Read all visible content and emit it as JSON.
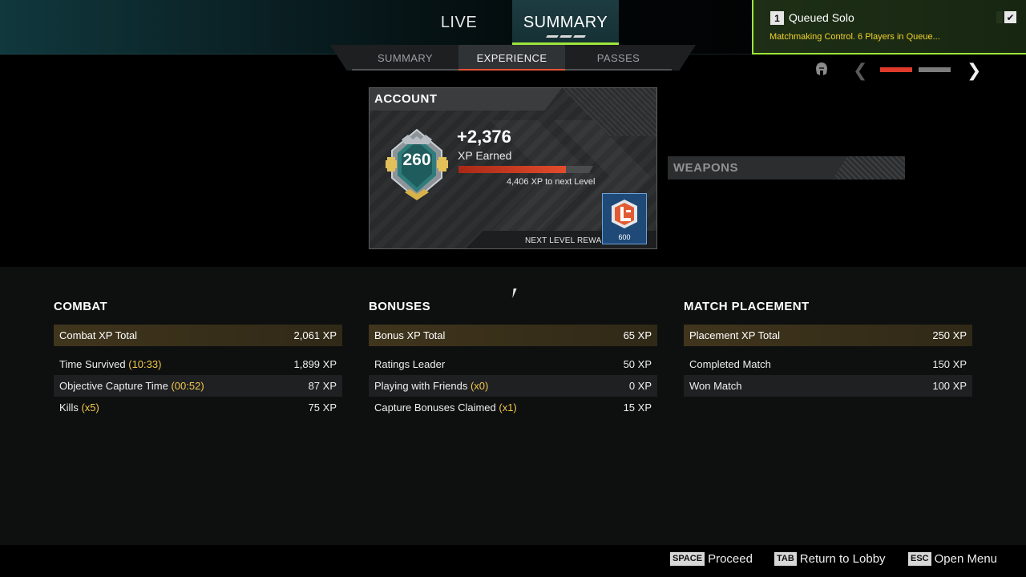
{
  "main_tabs": [
    {
      "label": "LIVE",
      "active": false
    },
    {
      "label": "SUMMARY",
      "active": true
    }
  ],
  "sub_tabs": [
    {
      "label": "SUMMARY",
      "active": false
    },
    {
      "label": "EXPERIENCE",
      "active": true
    },
    {
      "label": "PASSES",
      "active": false
    }
  ],
  "queue": {
    "number": "1",
    "title": "Queued Solo",
    "status": "Matchmaking Control. 6 Players in Queue...",
    "checkbox_glyph": "✔",
    "accent_color": "#9ee63b"
  },
  "pager": {
    "icon": "helmet-icon",
    "page": 1,
    "total_pages": 2,
    "active_color": "#e03a2a"
  },
  "account": {
    "title": "ACCOUNT",
    "level": "260",
    "xp_earned": "+2,376",
    "xp_earned_label": "XP Earned",
    "xp_to_next": "4,406 XP to next Level",
    "progress_fraction": 0.8,
    "next_reward_label": "NEXT LEVEL REWARD",
    "reward_amount": "600",
    "reward_icon": "legend-tokens-icon"
  },
  "weapons": {
    "title": "WEAPONS"
  },
  "combat": {
    "title": "COMBAT",
    "total_label": "Combat XP Total",
    "total_value": "2,061 XP",
    "rows": [
      {
        "label": "Time Survived",
        "mult": "(10:33)",
        "value": "1,899 XP"
      },
      {
        "label": "Objective Capture Time",
        "mult": "(00:52)",
        "value": "87 XP"
      },
      {
        "label": "Kills",
        "mult": "(x5)",
        "value": "75 XP"
      }
    ]
  },
  "bonuses": {
    "title": "BONUSES",
    "total_label": "Bonus XP Total",
    "total_value": "65 XP",
    "rows": [
      {
        "label": "Ratings Leader",
        "mult": "",
        "value": "50 XP"
      },
      {
        "label": "Playing with Friends",
        "mult": "(x0)",
        "value": "0 XP"
      },
      {
        "label": "Capture Bonuses Claimed",
        "mult": "(x1)",
        "value": "15 XP"
      }
    ]
  },
  "placement": {
    "title": "MATCH PLACEMENT",
    "total_label": "Placement XP Total",
    "total_value": "250 XP",
    "rows": [
      {
        "label": "Completed Match",
        "mult": "",
        "value": "150 XP"
      },
      {
        "label": "Won Match",
        "mult": "",
        "value": "100 XP"
      }
    ]
  },
  "footer_hints": [
    {
      "key": "SPACE",
      "label": "Proceed"
    },
    {
      "key": "TAB",
      "label": "Return to Lobby"
    },
    {
      "key": "ESC",
      "label": "Open Menu"
    }
  ]
}
